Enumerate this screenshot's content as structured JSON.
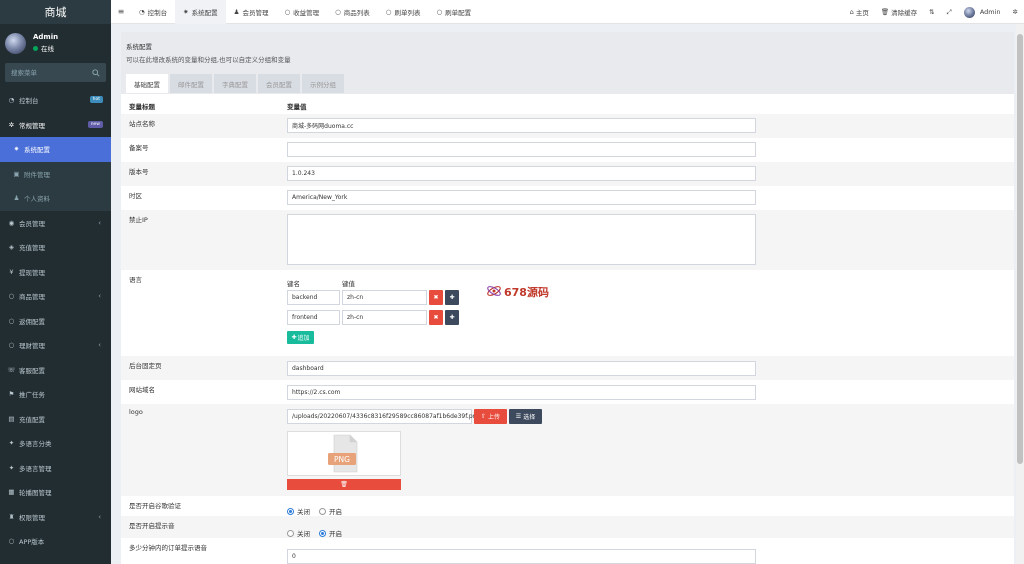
{
  "brand": "商城",
  "user": {
    "name": "Admin",
    "status": "在线"
  },
  "sidebar": {
    "search_placeholder": "搜索菜单",
    "items": [
      {
        "label": "控制台",
        "icon": "dashboard-icon",
        "badge": "hot"
      },
      {
        "label": "常规管理",
        "icon": "cogs-icon",
        "badge": "new"
      },
      {
        "label": "系统配置",
        "icon": "gear-icon"
      },
      {
        "label": "附件管理",
        "icon": "file-image-icon"
      },
      {
        "label": "个人资料",
        "icon": "user-icon"
      },
      {
        "label": "会员管理",
        "icon": "user-circle-icon"
      },
      {
        "label": "充值管理",
        "icon": "recharge-icon"
      },
      {
        "label": "提现管理",
        "icon": "withdraw-icon"
      },
      {
        "label": "商品管理",
        "icon": "circle-icon"
      },
      {
        "label": "返佣配置",
        "icon": "circle-icon"
      },
      {
        "label": "理财管理",
        "icon": "circle-icon"
      },
      {
        "label": "客服配置",
        "icon": "service-icon"
      },
      {
        "label": "推广任务",
        "icon": "share-icon"
      },
      {
        "label": "充值配置",
        "icon": "recharge-config-icon"
      },
      {
        "label": "多语言分类",
        "icon": "language-icon"
      },
      {
        "label": "多语言管理",
        "icon": "language-icon"
      },
      {
        "label": "轮播图管理",
        "icon": "carousel-icon"
      },
      {
        "label": "权限管理",
        "icon": "group-icon"
      },
      {
        "label": "APP版本",
        "icon": "circle-icon"
      }
    ]
  },
  "topbar": {
    "tabs": [
      {
        "label": "控制台"
      },
      {
        "label": "系统配置"
      },
      {
        "label": "会员管理"
      },
      {
        "label": "收益管理"
      },
      {
        "label": "商品列表"
      },
      {
        "label": "刷单列表"
      },
      {
        "label": "刷单配置"
      }
    ],
    "home": "主页",
    "clear_cache": "清除缓存",
    "user": "Admin"
  },
  "panel": {
    "title": "系统配置",
    "subtitle": "可以在此增改系统的变量和分组,也可以自定义分组和变量",
    "tabs": [
      "基础配置",
      "邮件配置",
      "字典配置",
      "会员配置",
      "示例分组"
    ],
    "col_title": "变量标题",
    "col_value": "变量值"
  },
  "form": {
    "site_name": {
      "label": "站点名称",
      "value": "商城-多码网duoma.cc"
    },
    "beian": {
      "label": "备案号",
      "value": ""
    },
    "version": {
      "label": "版本号",
      "value": "1.0.243"
    },
    "timezone": {
      "label": "时区",
      "value": "America/New_York"
    },
    "forbidden_ip": {
      "label": "禁止IP",
      "value": ""
    },
    "language": {
      "label": "语言",
      "key_header": "键名",
      "value_header": "键值",
      "rows": [
        {
          "key": "backend",
          "value": "zh-cn"
        },
        {
          "key": "frontend",
          "value": "zh-cn"
        }
      ],
      "append": "追加"
    },
    "fixed_page": {
      "label": "后台固定页",
      "value": "dashboard"
    },
    "site_domain": {
      "label": "网站域名",
      "value": "https://2.cs.com"
    },
    "logo": {
      "label": "logo",
      "value": "/uploads/20220607/4336c8316f29589cc86087af1b6de39f.png",
      "upload": "上传",
      "choose": "选择",
      "preview_text": "PNG"
    },
    "captcha": {
      "label": "是否开启谷歌验证",
      "options": [
        "关闭",
        "开启"
      ],
      "selected": 0
    },
    "tips": {
      "label": "是否开启提示音",
      "options": [
        "关闭",
        "开启"
      ],
      "selected": 1
    },
    "order_tip": {
      "label": "多少分钟内的订单提示语音",
      "value": "0"
    }
  },
  "watermark": {
    "text": "678源码"
  }
}
